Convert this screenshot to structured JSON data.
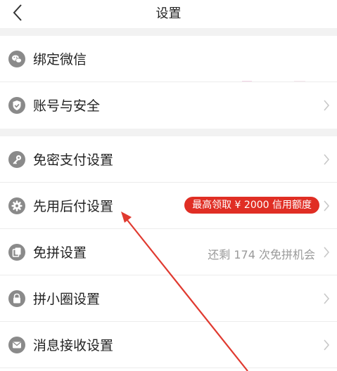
{
  "header": {
    "title": "设置",
    "back_icon": "chevron-left-icon"
  },
  "colors": {
    "accent": "#e02e24",
    "icon_gray": "#8a8a8a",
    "chevron": "#c8c8c8",
    "gap": "#f2f2f2",
    "annotation_arrow": "#e03a30"
  },
  "rows": [
    {
      "label": "绑定微信",
      "icon": "wechat-icon",
      "right_text": ""
    },
    {
      "label": "账号与安全",
      "icon": "shield-check-icon",
      "right_text": ""
    },
    {
      "label": "免密支付设置",
      "icon": "key-icon",
      "right_text": ""
    },
    {
      "label": "先用后付设置",
      "icon": "gear-icon",
      "badge": "最高领取 ¥ 2000 信用额度"
    },
    {
      "label": "免拼设置",
      "icon": "copy-icon",
      "right_text": "还剩 174 次免拼机会"
    },
    {
      "label": "拼小圈设置",
      "icon": "lock-icon",
      "right_text": ""
    },
    {
      "label": "消息接收设置",
      "icon": "message-icon",
      "right_text": ""
    }
  ]
}
